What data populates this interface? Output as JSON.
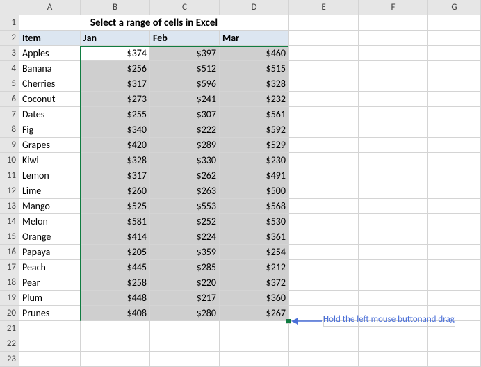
{
  "columns": [
    "A",
    "B",
    "C",
    "D",
    "E",
    "F",
    "G"
  ],
  "title": "Select a range of cells in Excel",
  "headers": {
    "item": "Item",
    "jan": "Jan",
    "feb": "Feb",
    "mar": "Mar"
  },
  "rows": [
    {
      "n": 3,
      "item": "Apples",
      "jan": "$374",
      "feb": "$397",
      "mar": "$460"
    },
    {
      "n": 4,
      "item": "Banana",
      "jan": "$256",
      "feb": "$512",
      "mar": "$515"
    },
    {
      "n": 5,
      "item": "Cherries",
      "jan": "$317",
      "feb": "$596",
      "mar": "$328"
    },
    {
      "n": 6,
      "item": "Coconut",
      "jan": "$273",
      "feb": "$241",
      "mar": "$232"
    },
    {
      "n": 7,
      "item": "Dates",
      "jan": "$255",
      "feb": "$307",
      "mar": "$561"
    },
    {
      "n": 8,
      "item": "Fig",
      "jan": "$340",
      "feb": "$222",
      "mar": "$592"
    },
    {
      "n": 9,
      "item": "Grapes",
      "jan": "$420",
      "feb": "$289",
      "mar": "$529"
    },
    {
      "n": 10,
      "item": "Kiwi",
      "jan": "$328",
      "feb": "$330",
      "mar": "$230"
    },
    {
      "n": 11,
      "item": "Lemon",
      "jan": "$317",
      "feb": "$262",
      "mar": "$491"
    },
    {
      "n": 12,
      "item": "Lime",
      "jan": "$260",
      "feb": "$263",
      "mar": "$500"
    },
    {
      "n": 13,
      "item": "Mango",
      "jan": "$525",
      "feb": "$553",
      "mar": "$568"
    },
    {
      "n": 14,
      "item": "Melon",
      "jan": "$581",
      "feb": "$252",
      "mar": "$530"
    },
    {
      "n": 15,
      "item": "Orange",
      "jan": "$414",
      "feb": "$224",
      "mar": "$361"
    },
    {
      "n": 16,
      "item": "Papaya",
      "jan": "$205",
      "feb": "$359",
      "mar": "$254"
    },
    {
      "n": 17,
      "item": "Peach",
      "jan": "$445",
      "feb": "$285",
      "mar": "$212"
    },
    {
      "n": 18,
      "item": "Pear",
      "jan": "$258",
      "feb": "$220",
      "mar": "$372"
    },
    {
      "n": 19,
      "item": "Plum",
      "jan": "$448",
      "feb": "$217",
      "mar": "$360"
    },
    {
      "n": 20,
      "item": "Prunes",
      "jan": "$408",
      "feb": "$280",
      "mar": "$267"
    }
  ],
  "empty_rows": [
    21,
    22,
    23
  ],
  "annotation": {
    "line1": "Hold the left mouse button",
    "line2": "and drag"
  },
  "chart_data": {
    "type": "table",
    "title": "Select a range of cells in Excel",
    "columns": [
      "Item",
      "Jan",
      "Feb",
      "Mar"
    ],
    "data": [
      [
        "Apples",
        374,
        397,
        460
      ],
      [
        "Banana",
        256,
        512,
        515
      ],
      [
        "Cherries",
        317,
        596,
        328
      ],
      [
        "Coconut",
        273,
        241,
        232
      ],
      [
        "Dates",
        255,
        307,
        561
      ],
      [
        "Fig",
        340,
        222,
        592
      ],
      [
        "Grapes",
        420,
        289,
        529
      ],
      [
        "Kiwi",
        328,
        330,
        230
      ],
      [
        "Lemon",
        317,
        262,
        491
      ],
      [
        "Lime",
        260,
        263,
        500
      ],
      [
        "Mango",
        525,
        553,
        568
      ],
      [
        "Melon",
        581,
        252,
        530
      ],
      [
        "Orange",
        414,
        224,
        361
      ],
      [
        "Papaya",
        205,
        359,
        254
      ],
      [
        "Peach",
        445,
        285,
        212
      ],
      [
        "Pear",
        258,
        220,
        372
      ],
      [
        "Plum",
        448,
        217,
        360
      ],
      [
        "Prunes",
        408,
        280,
        267
      ]
    ],
    "selection": "B3:D20"
  }
}
